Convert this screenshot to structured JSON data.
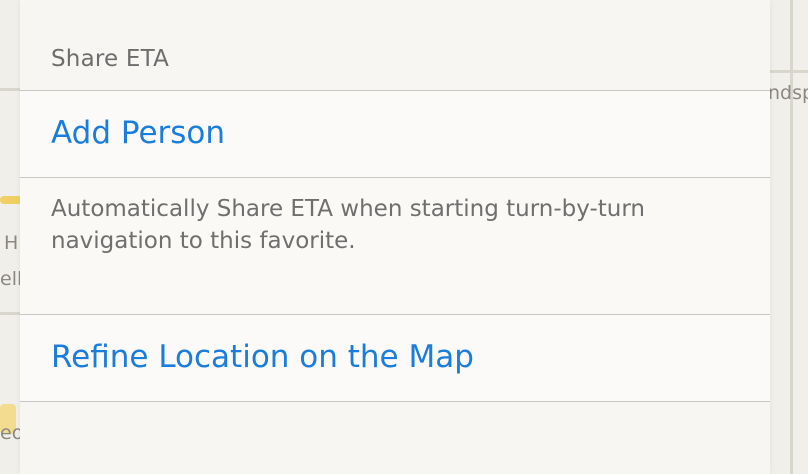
{
  "map": {
    "label_right": "ndsp",
    "label_left_1": "H",
    "label_left_2": "ell",
    "label_left_3": "eo"
  },
  "share_eta": {
    "section_header": "Share ETA",
    "add_person_label": "Add Person",
    "footer_text": "Automatically Share ETA when starting turn-by-turn navigation to this favorite."
  },
  "refine_location": {
    "label": "Refine Location on the Map"
  },
  "colors": {
    "accent": "#1b7ddb",
    "card_background": "#faf9f6",
    "secondary_text": "#6f6f6f"
  }
}
